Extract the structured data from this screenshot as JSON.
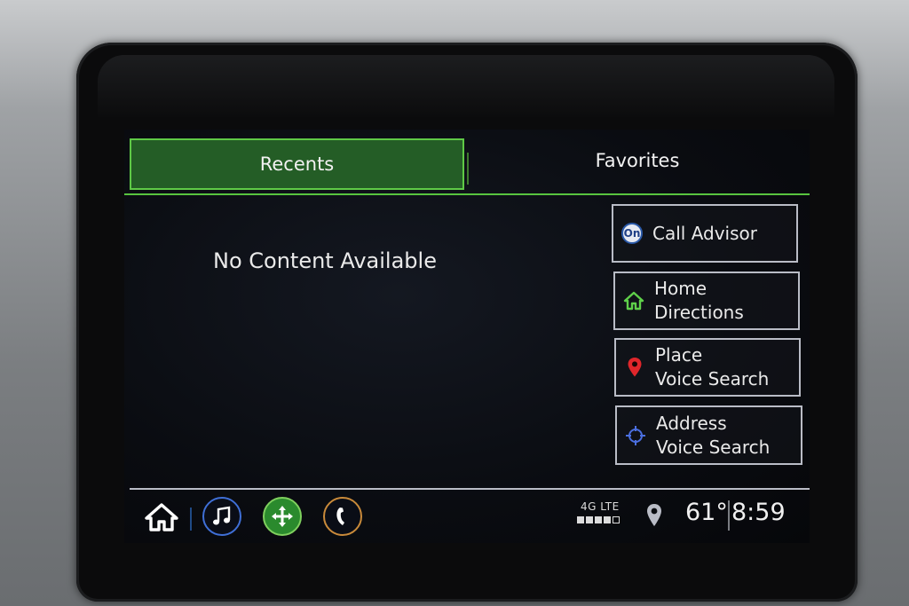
{
  "tabs": [
    {
      "label": "Recents",
      "selected": true
    },
    {
      "label": "Favorites",
      "selected": false
    }
  ],
  "main": {
    "empty_message": "No Content Available"
  },
  "shortcuts": {
    "call_advisor": {
      "label": "Call Advisor",
      "icon": "onstar-icon",
      "icon_text": "On"
    },
    "home_directions": {
      "line1": "Home",
      "line2": "Directions",
      "icon": "home-icon"
    },
    "place_voice_search": {
      "line1": "Place",
      "line2": "Voice Search",
      "icon": "location-pin-icon"
    },
    "address_voice_search": {
      "line1": "Address",
      "line2": "Voice Search",
      "icon": "crosshair-icon"
    }
  },
  "status_bar": {
    "network": "4G LTE",
    "signal_bars": {
      "filled": 4,
      "total": 5
    },
    "temperature": "61°",
    "time": "8:59"
  },
  "bottom_nav": [
    {
      "name": "home",
      "icon": "home-icon"
    },
    {
      "name": "audio",
      "icon": "music-note-icon"
    },
    {
      "name": "navigation",
      "icon": "navigation-icon"
    },
    {
      "name": "phone",
      "icon": "phone-icon"
    }
  ],
  "colors": {
    "accent_green": "#58c43f",
    "selected_tab_bg": "#245d26",
    "audio_blue": "#3f6fd6",
    "phone_orange": "#c98a3a",
    "pin_red": "#e0262b",
    "home_green": "#5fd04a",
    "crosshair_blue": "#4b6fe0"
  }
}
